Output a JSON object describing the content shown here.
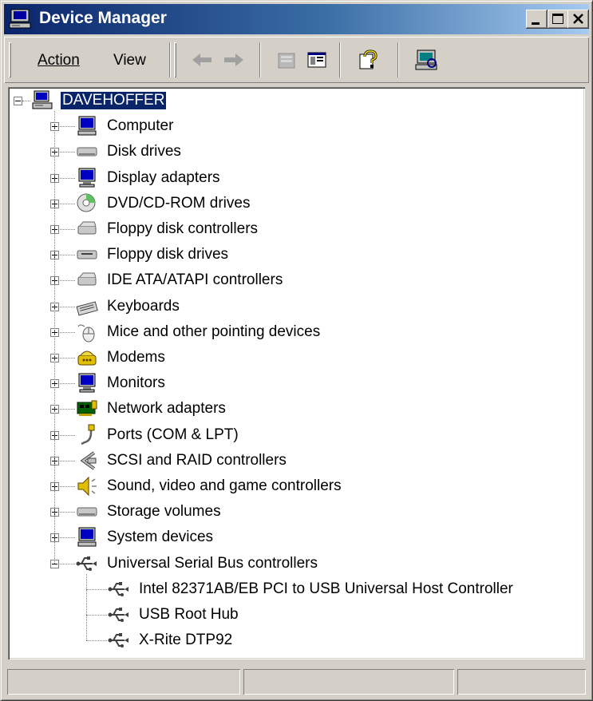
{
  "window": {
    "title": "Device Manager"
  },
  "menu": {
    "action": "Action",
    "view": "View"
  },
  "tree": {
    "root": "DAVEHOFFER",
    "categories": [
      {
        "label": "Computer",
        "icon": "computer-icon"
      },
      {
        "label": "Disk drives",
        "icon": "disk-drive-icon"
      },
      {
        "label": "Display adapters",
        "icon": "display-adapter-icon"
      },
      {
        "label": "DVD/CD-ROM drives",
        "icon": "cdrom-icon"
      },
      {
        "label": "Floppy disk controllers",
        "icon": "floppy-controller-icon"
      },
      {
        "label": "Floppy disk drives",
        "icon": "floppy-drive-icon"
      },
      {
        "label": "IDE ATA/ATAPI controllers",
        "icon": "ide-controller-icon"
      },
      {
        "label": "Keyboards",
        "icon": "keyboard-icon"
      },
      {
        "label": "Mice and other pointing devices",
        "icon": "mouse-icon"
      },
      {
        "label": "Modems",
        "icon": "modem-icon"
      },
      {
        "label": "Monitors",
        "icon": "monitor-icon"
      },
      {
        "label": "Network adapters",
        "icon": "network-adapter-icon"
      },
      {
        "label": "Ports (COM & LPT)",
        "icon": "port-icon"
      },
      {
        "label": "SCSI and RAID controllers",
        "icon": "scsi-icon"
      },
      {
        "label": "Sound, video and game controllers",
        "icon": "sound-icon"
      },
      {
        "label": "Storage volumes",
        "icon": "storage-volume-icon"
      },
      {
        "label": "System devices",
        "icon": "system-device-icon"
      },
      {
        "label": "Universal Serial Bus controllers",
        "icon": "usb-icon"
      }
    ],
    "usb_children": [
      {
        "label": "Intel 82371AB/EB PCI to USB Universal Host Controller",
        "icon": "usb-icon"
      },
      {
        "label": "USB Root Hub",
        "icon": "usb-icon"
      },
      {
        "label": "X-Rite DTP92",
        "icon": "usb-icon"
      }
    ]
  },
  "colors": {
    "title_start": "#0a246a",
    "title_end": "#a6caf0",
    "selection": "#0a246a",
    "face": "#d4d0c8"
  }
}
